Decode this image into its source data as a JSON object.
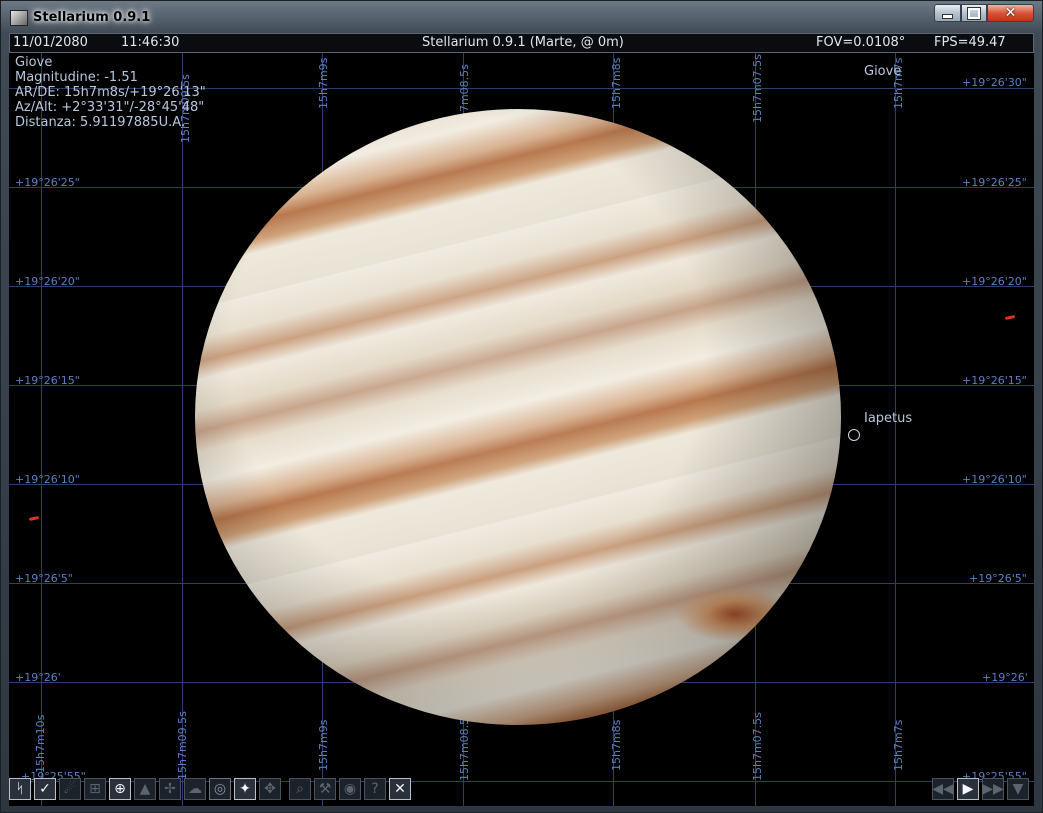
{
  "window": {
    "title": "Stellarium 0.9.1",
    "controls": {
      "minimize": "minimize",
      "maximize": "maximize",
      "close": "close"
    }
  },
  "topbar": {
    "date": "11/01/2080",
    "time": "11:46:30",
    "location": "Stellarium 0.9.1 (Marte,  @ 0m)",
    "fov": "FOV=0.0108°",
    "fps": "FPS=49.47"
  },
  "object_info": {
    "name": "Giove",
    "magnitude": "Magnitudine: -1.51",
    "ra_de": "AR/DE: 15h7m8s/+19°26'13\"",
    "az_alt": "Az/Alt: +2°33'31\"/-28°45'48\"",
    "distance": "Distanza: 5.91197885U.A."
  },
  "labels": {
    "planet": "Giove",
    "moon": "Iapetus"
  },
  "grid": {
    "dec_left": [
      "+19°26'25\"",
      "+19°26'20\"",
      "+19°26'15\"",
      "+19°26'10\"",
      "+19°26'5\"",
      "+19°26'"
    ],
    "dec_right": [
      "+19°26'30\"",
      "+19°26'25\"",
      "+19°26'20\"",
      "+19°26'15\"",
      "+19°26'10\"",
      "+19°26'5\"",
      "+19°26'",
      "+19°25'55\""
    ],
    "dec_bottom_left": "+19°25'55\"",
    "ra_top": [
      "15h7m09.5s",
      "15h7m9s",
      "15h7m08.5s",
      "15h7m8s",
      "15h7m07.5s",
      "15h7m7s"
    ],
    "ra_bottom": [
      "15h7m10s",
      "15h7m09.5s",
      "15h7m9s",
      "15h7m08.5s",
      "15h7m8s",
      "15h7m07.5s",
      "15h7m7s"
    ]
  },
  "toolbar": {
    "left_icons": [
      "constellation-lines-icon",
      "constellation-names-icon",
      "constellation-art-icon",
      "equatorial-grid-icon",
      "azimuthal-grid-icon",
      "ground-icon",
      "cardinal-points-icon",
      "atmosphere-icon",
      "nebulae-icon",
      "equatorial-mount-icon",
      "satellite-icon",
      "night-mode-icon",
      "search-icon",
      "config-icon",
      "view-icon",
      "help-icon",
      "quit-icon"
    ],
    "right_icons": [
      "rewind-icon",
      "play-icon",
      "fast-forward-icon",
      "time-now-icon"
    ]
  }
}
